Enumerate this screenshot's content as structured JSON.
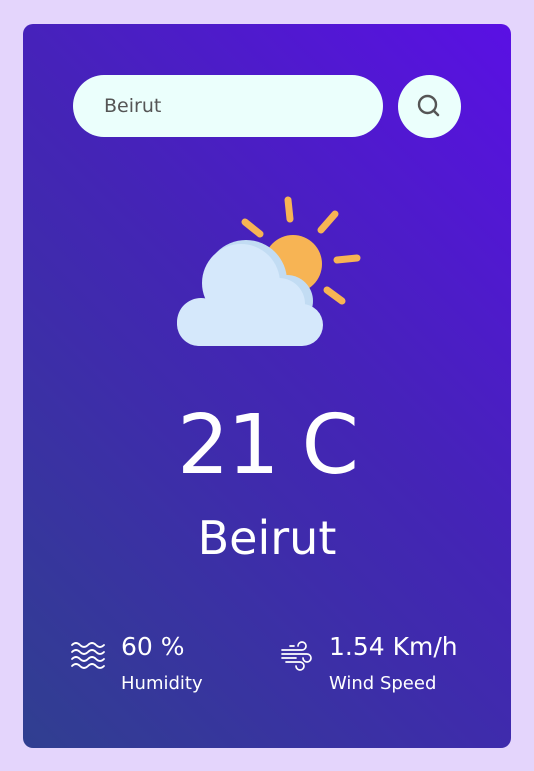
{
  "search": {
    "value": "Beirut",
    "placeholder": "",
    "button_icon": "search-icon"
  },
  "weather": {
    "icon": "partly-cloudy-icon",
    "temperature": "21 C",
    "city": "Beirut"
  },
  "details": {
    "humidity": {
      "icon": "humidity-waves-icon",
      "value": "60 %",
      "label": "Humidity"
    },
    "wind": {
      "icon": "wind-icon",
      "value": "1.54 Km/h",
      "label": "Wind Speed"
    }
  },
  "colors": {
    "page_background": "#e4d5fc",
    "card_gradient_start": "#5a10e4",
    "card_gradient_end": "#303f90",
    "input_background": "#ebfffc",
    "sun": "#f7b454",
    "cloud": "#d5e8fb"
  }
}
